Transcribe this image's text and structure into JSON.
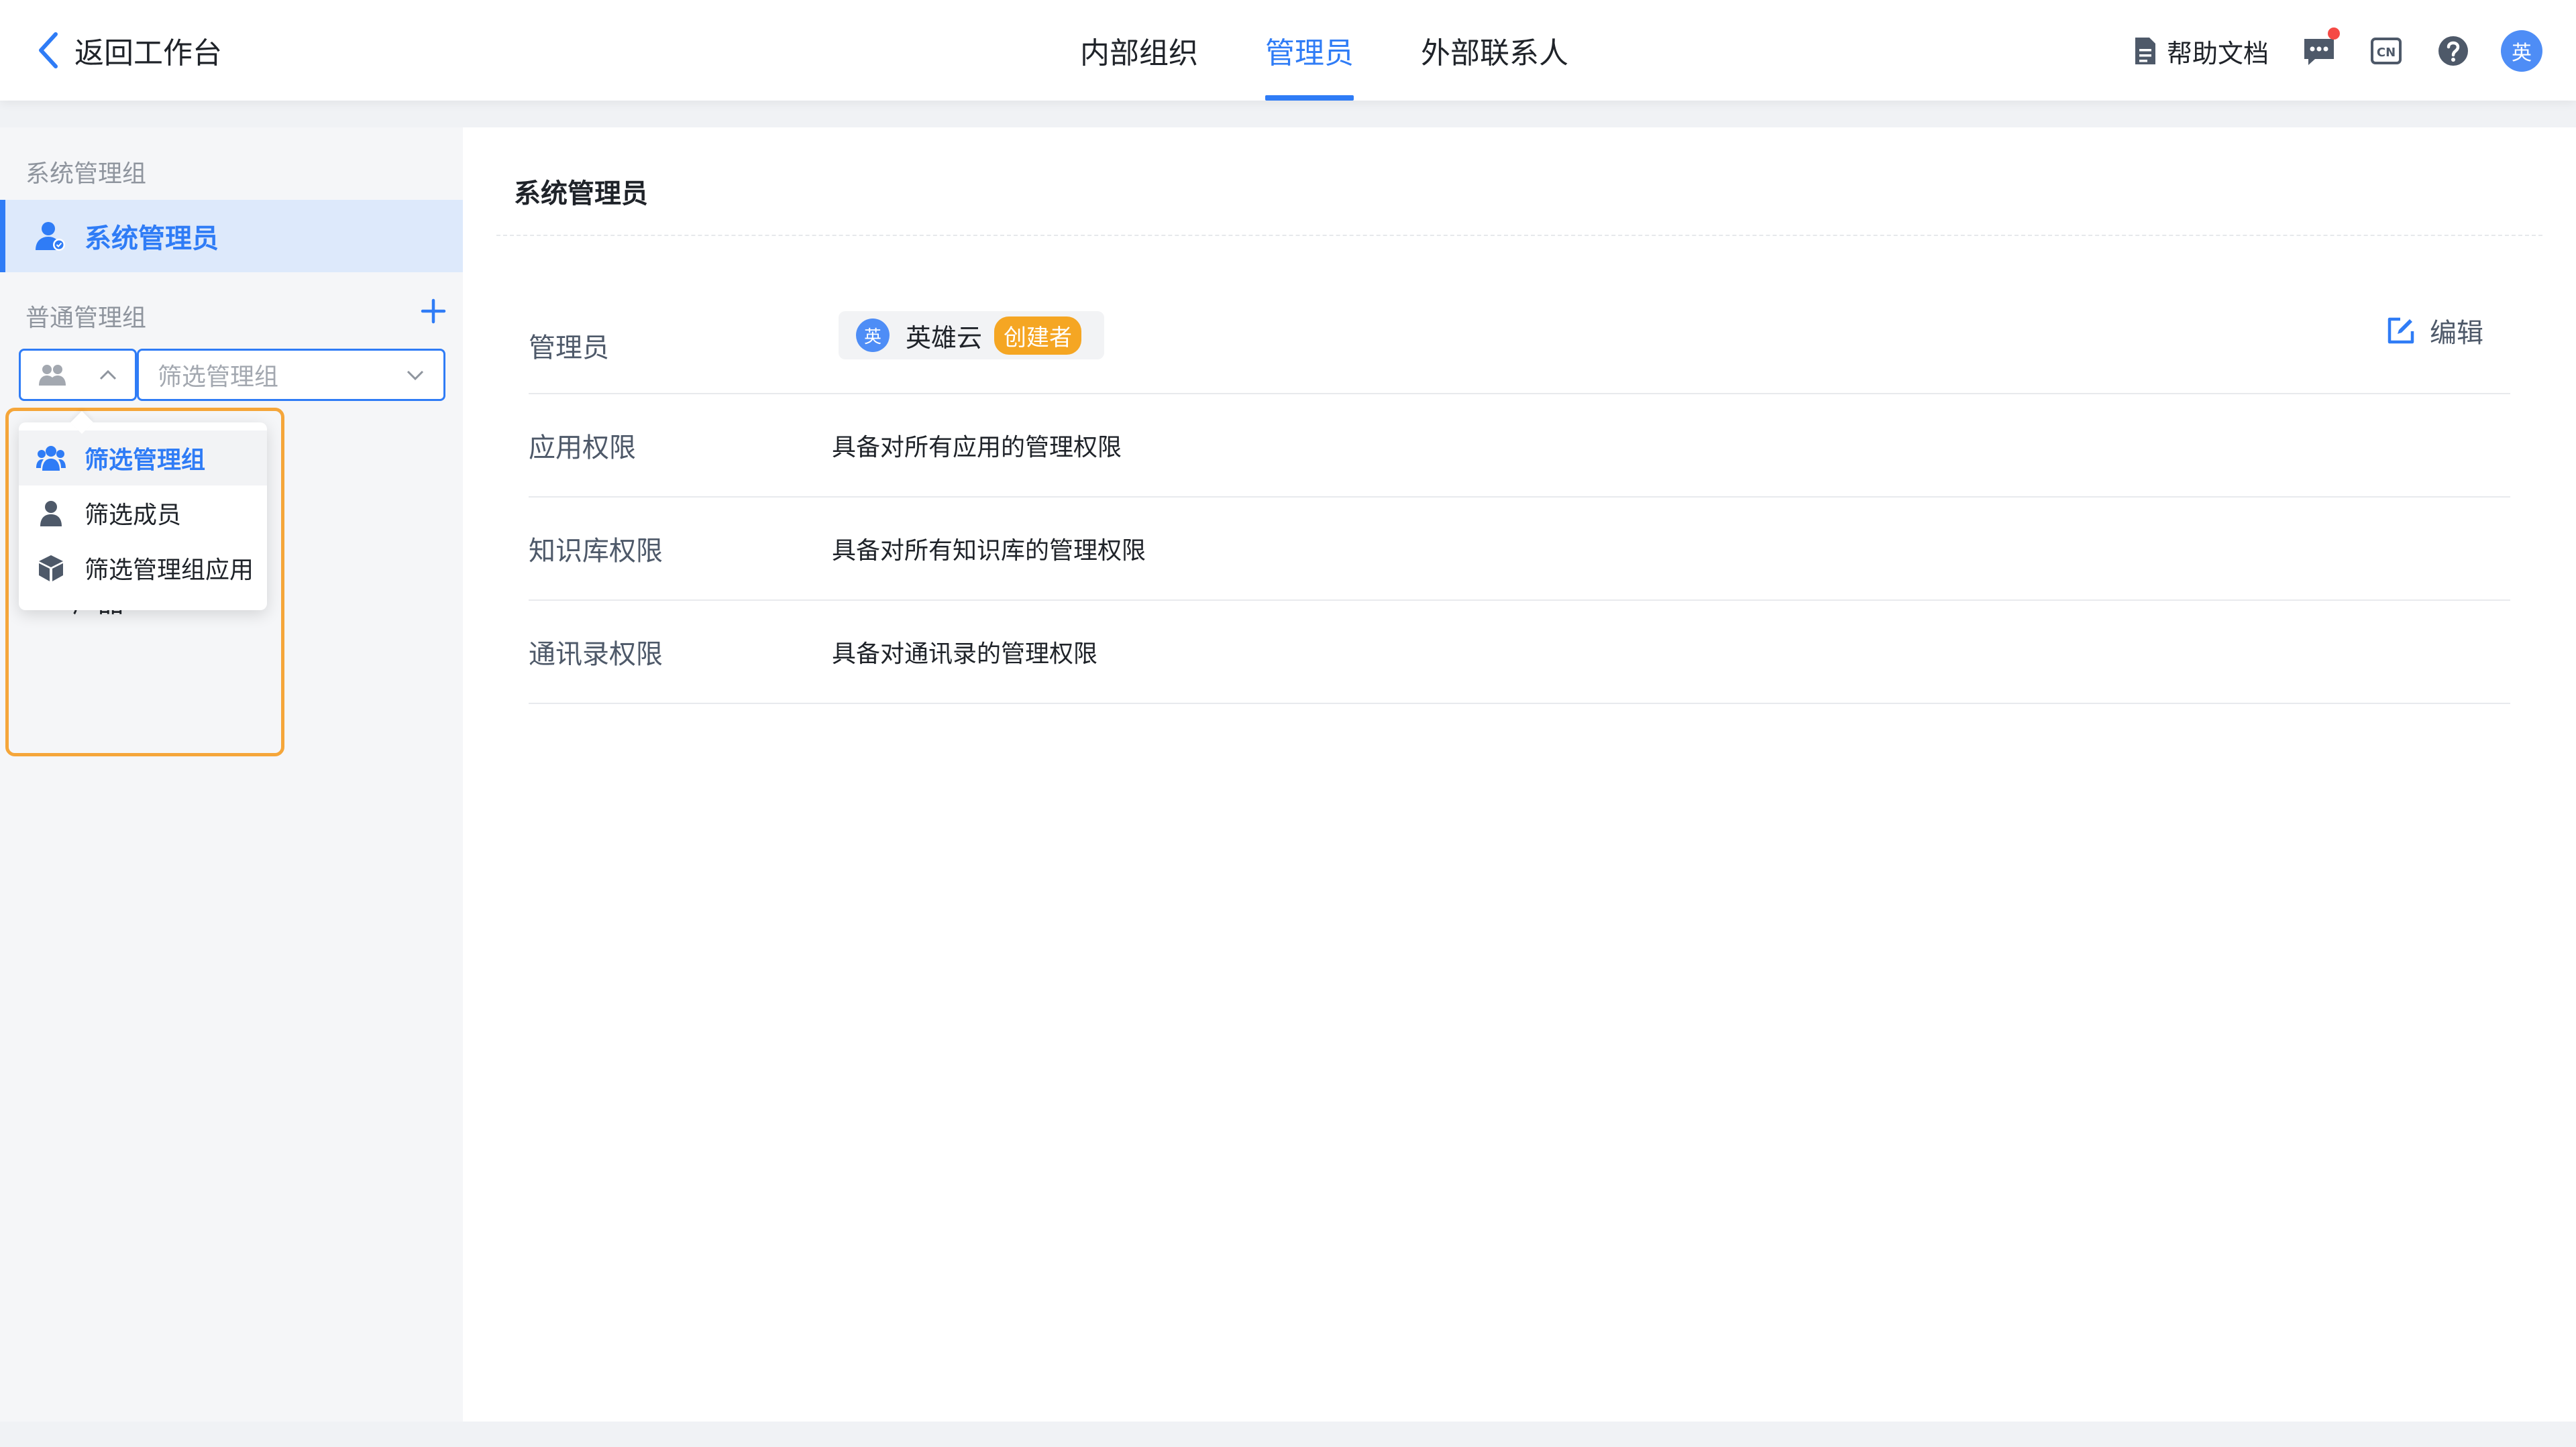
{
  "header": {
    "back_label": "返回工作台",
    "tabs": [
      {
        "label": "内部组织"
      },
      {
        "label": "管理员"
      },
      {
        "label": "外部联系人"
      }
    ],
    "active_tab": "管理员",
    "help_docs_label": "帮助文档",
    "language_icon_text": "CN",
    "avatar_text": "英"
  },
  "sidebar": {
    "section_system": "系统管理组",
    "active_item": "系统管理员",
    "section_normal": "普通管理组",
    "filter_placeholder": "筛选管理组",
    "dropdown_items": [
      {
        "label": "筛选管理组",
        "icon": "group-icon"
      },
      {
        "label": "筛选成员",
        "icon": "user-icon"
      },
      {
        "label": "筛选管理组应用",
        "icon": "cube-icon"
      }
    ],
    "partially_hidden_item": "产品"
  },
  "main": {
    "title": "系统管理员",
    "rows": [
      {
        "label": "管理员"
      },
      {
        "label": "应用权限",
        "value": "具备对所有应用的管理权限"
      },
      {
        "label": "知识库权限",
        "value": "具备对所有知识库的管理权限"
      },
      {
        "label": "通讯录权限",
        "value": "具备对通讯录的管理权限"
      }
    ],
    "admin": {
      "avatar": "英",
      "name": "英雄云",
      "tag": "创建者"
    },
    "edit_label": "编辑"
  },
  "colors": {
    "accent": "#2f7cf6",
    "highlight_frame": "#f5a63a",
    "creator_tag": "#f5a623",
    "notification_dot": "#f54a45"
  }
}
